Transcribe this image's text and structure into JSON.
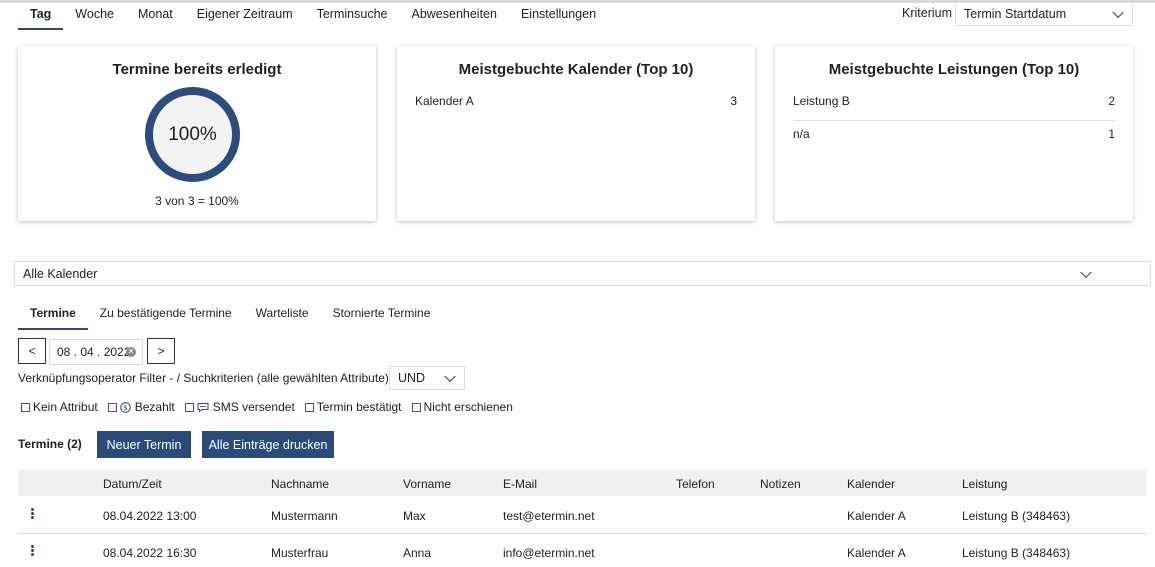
{
  "nav": {
    "tabs": [
      {
        "label": "Tag"
      },
      {
        "label": "Woche"
      },
      {
        "label": "Monat"
      },
      {
        "label": "Eigener Zeitraum"
      },
      {
        "label": "Terminsuche"
      },
      {
        "label": "Abwesenheiten"
      },
      {
        "label": "Einstellungen"
      }
    ],
    "active_tab": "Tag",
    "kriterium_label": "Kriterium",
    "kriterium_value": "Termin Startdatum"
  },
  "cards": {
    "done": {
      "title": "Termine bereits erledigt",
      "percent_text": "100%",
      "percent_value": 100,
      "caption": "3 von 3 = 100%"
    },
    "calendars": {
      "title": "Meistgebuchte Kalender (Top 10)",
      "rows": [
        {
          "name": "Kalender A",
          "count": "3"
        }
      ]
    },
    "services": {
      "title": "Meistgebuchte Leistungen (Top 10)",
      "rows": [
        {
          "name": "Leistung B",
          "count": "2"
        },
        {
          "name": "n/a",
          "count": "1"
        }
      ]
    }
  },
  "calendar_filter": {
    "value": "Alle Kalender"
  },
  "subtabs": [
    {
      "label": "Termine"
    },
    {
      "label": "Zu bestätigende Termine"
    },
    {
      "label": "Warteliste"
    },
    {
      "label": "Stornierte Termine"
    }
  ],
  "date_nav": {
    "prev": "<",
    "next": ">",
    "date": "08 . 04 . 2022"
  },
  "operator": {
    "label": "Verknüpfungsoperator Filter - / Suchkriterien (alle gewählten Attribute)",
    "value": "UND"
  },
  "filters": [
    {
      "label": "Kein Attribut",
      "icon": ""
    },
    {
      "label": "Bezahlt",
      "icon": "dollar-icon"
    },
    {
      "label": "SMS versendet",
      "icon": "sms-icon"
    },
    {
      "label": "Termin bestätigt",
      "icon": ""
    },
    {
      "label": "Nicht erschienen",
      "icon": ""
    }
  ],
  "appointments": {
    "heading": "Termine (2)",
    "new_button": "Neuer Termin",
    "print_button": "Alle Einträge drucken",
    "columns": [
      "Datum/Zeit",
      "Nachname",
      "Vorname",
      "E-Mail",
      "Telefon",
      "Notizen",
      "Kalender",
      "Leistung"
    ],
    "rows": [
      {
        "datetime": "08.04.2022 13:00",
        "lastname": "Mustermann",
        "firstname": "Max",
        "email": "test@etermin.net",
        "phone": "",
        "notes": "",
        "calendar": "Kalender A",
        "service": "Leistung B (348463)"
      },
      {
        "datetime": "08.04.2022 16:30",
        "lastname": "Musterfrau",
        "firstname": "Anna",
        "email": "info@etermin.net",
        "phone": "",
        "notes": "",
        "calendar": "Kalender A",
        "service": "Leistung B (348463)"
      }
    ]
  },
  "colors": {
    "accent": "#2b4a7a",
    "donut": "#2c4c7e"
  }
}
